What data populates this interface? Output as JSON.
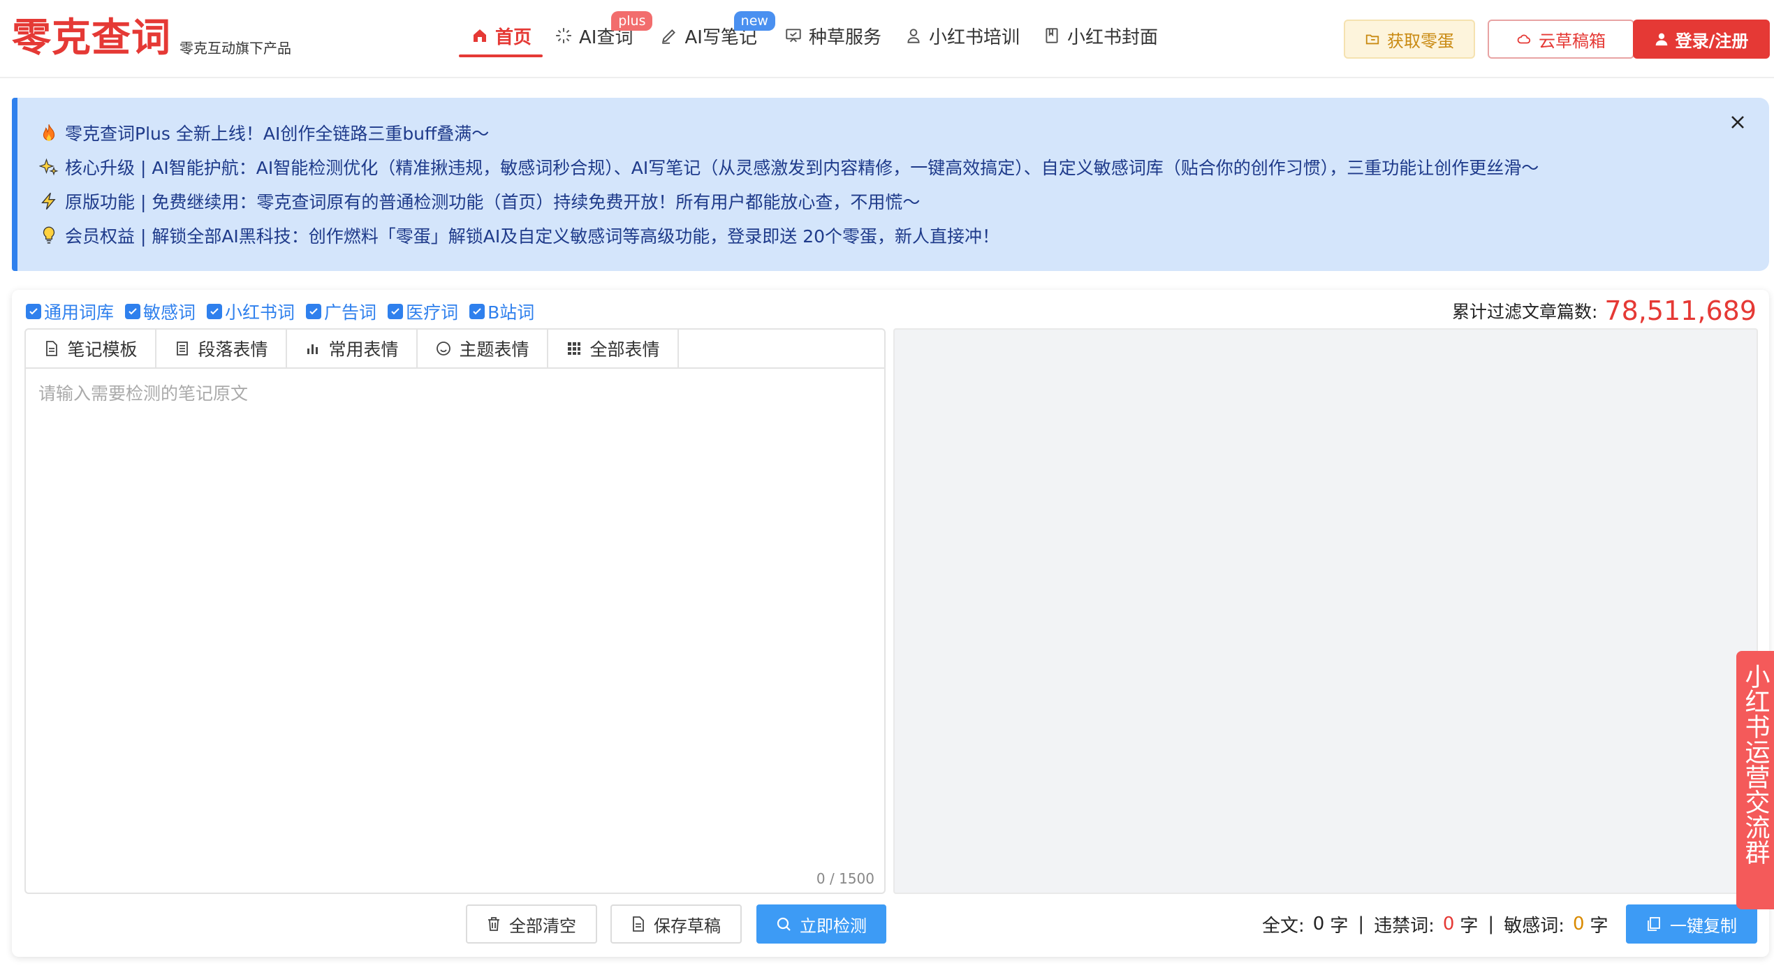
{
  "header": {
    "logo": "零克查词",
    "logo_sub": "零克互动旗下产品",
    "nav": [
      {
        "label": "首页",
        "icon": "home-icon"
      },
      {
        "label": "AI查词",
        "icon": "sparkle-icon",
        "badge": "plus"
      },
      {
        "label": "AI写笔记",
        "icon": "pen-icon",
        "badge": "new"
      },
      {
        "label": "种草服务",
        "icon": "board-icon"
      },
      {
        "label": "小红书培训",
        "icon": "user-icon"
      },
      {
        "label": "小红书封面",
        "icon": "book-icon"
      }
    ],
    "get_eggs": "获取零蛋",
    "cloud_drafts": "云草稿箱",
    "login": "登录/注册"
  },
  "notice": {
    "lines": [
      {
        "icon": "fire-icon",
        "text": "零克查词Plus 全新上线！AI创作全链路三重buff叠满～"
      },
      {
        "icon": "sparkles-icon",
        "text": "核心升级 | AI智能护航：AI智能检测优化（精准揪违规，敏感词秒合规）、AI写笔记（从灵感激发到内容精修，一键高效搞定）、自定义敏感词库（贴合你的创作习惯），三重功能让创作更丝滑～"
      },
      {
        "icon": "lightning-icon",
        "text": "原版功能 | 免费继续用：零克查词原有的普通检测功能（首页）持续免费开放！所有用户都能放心查，不用慌～"
      },
      {
        "icon": "bulb-icon",
        "text": "会员权益 | 解锁全部AI黑科技：创作燃料「零蛋」解锁AI及自定义敏感词等高级功能，登录即送 20个零蛋，新人直接冲！"
      }
    ]
  },
  "filters": [
    "通用词库",
    "敏感词",
    "小红书词",
    "广告词",
    "医疗词",
    "B站词"
  ],
  "counter": {
    "label": "累计过滤文章篇数:",
    "value": "78,511,689"
  },
  "tabs": [
    {
      "label": "笔记模板",
      "icon": "document-icon"
    },
    {
      "label": "段落表情",
      "icon": "list-icon"
    },
    {
      "label": "常用表情",
      "icon": "bar-chart-icon"
    },
    {
      "label": "主题表情",
      "icon": "smile-icon"
    },
    {
      "label": "全部表情",
      "icon": "grid-icon"
    }
  ],
  "editor": {
    "placeholder": "请输入需要检测的笔记原文",
    "char_count": "0 / 1500"
  },
  "actions": {
    "clear": "全部清空",
    "save": "保存草稿",
    "check": "立即检测",
    "copy": "一键复制"
  },
  "stats": {
    "total_label": "全文:",
    "total_value": "0",
    "unit1": "字",
    "banned_label": "违禁词:",
    "banned_value": "0",
    "unit2": "字",
    "sensitive_label": "敏感词:",
    "sensitive_value": "0",
    "unit3": "字",
    "sep1": "|",
    "sep2": "|"
  },
  "side_float": "小红书运营交流群",
  "colors": {
    "brand": "#e53935",
    "accent": "#2f80ed",
    "check_button": "#3d9bf5",
    "notice_bg": "#d4e5fb"
  }
}
